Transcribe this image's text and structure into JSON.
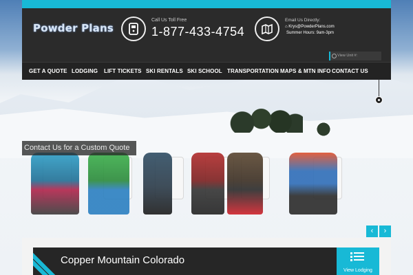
{
  "brand": {
    "logo_text": "Powder Plans",
    "accent": "#18b9d6"
  },
  "contact": {
    "call_label": "Call Us Toll Free",
    "phone": "1-877-433-4754",
    "email_label": "Email Us Directly:",
    "email": "Krys@PowderPlans.com",
    "hours": "Summer Hours: 9am-3pm"
  },
  "search": {
    "placeholder": "View Unit #:"
  },
  "nav": {
    "items": [
      {
        "label": "GET A QUOTE"
      },
      {
        "label": "LODGING"
      },
      {
        "label": "LIFT TICKETS"
      },
      {
        "label": "SKI RENTALS"
      },
      {
        "label": "SKI SCHOOL"
      },
      {
        "label": "TRANSPORTATION"
      },
      {
        "label": "MAPS & MTN INFO"
      },
      {
        "label": "CONTACT US"
      }
    ]
  },
  "hero": {
    "caption": "Contact Us for a Custom Quote"
  },
  "slider": {
    "prev": "‹",
    "next": "›"
  },
  "card": {
    "title": "Copper Mountain Colorado",
    "button_label": "View Lodging"
  },
  "icons": {
    "phone": "phone-icon",
    "email": "map-icon",
    "search": "search-icon",
    "list": "list-icon"
  }
}
